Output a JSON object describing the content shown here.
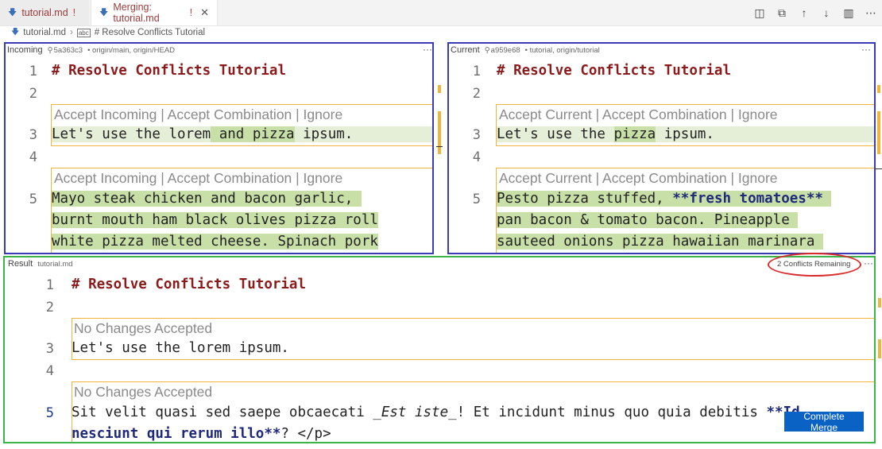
{
  "tabs": [
    {
      "label": "tutorial.md",
      "modified": "!",
      "close": ""
    },
    {
      "label": "Merging: tutorial.md",
      "modified": "!",
      "close": "✕"
    }
  ],
  "breadcrumb": {
    "file": "tutorial.md",
    "sep": "›",
    "symbol": "# Resolve Conflicts Tutorial"
  },
  "incoming": {
    "title": "Incoming",
    "commit": "5a363c3",
    "refs": "• origin/main, origin/HEAD",
    "menu": "···",
    "line_numbers": [
      "1",
      "2",
      "3",
      "4",
      "5"
    ],
    "heading": "# Resolve Conflicts Tutorial",
    "codelens1": "Accept Incoming | Accept Combination | Ignore",
    "line3": {
      "pre": "Let's use the lorem",
      "hl": " and pizza",
      "post": " ipsum."
    },
    "codelens2": "Accept Incoming | Accept Combination | Ignore",
    "block": [
      "Mayo steak chicken and bacon garlic, ",
      "burnt mouth ham black olives pizza roll",
      "white pizza melted cheese. Spinach pork"
    ]
  },
  "current": {
    "title": "Current",
    "commit": "a959e68",
    "refs": "• tutorial, origin/tutorial",
    "menu": "···",
    "line_numbers": [
      "1",
      "2",
      "3",
      "4",
      "5"
    ],
    "heading": "# Resolve Conflicts Tutorial",
    "codelens1": "Accept Current | Accept Combination | Ignore",
    "line3": {
      "pre": "Let's use the ",
      "hl": "pizza",
      "post": " ipsum."
    },
    "codelens2": "Accept Current | Accept Combination | Ignore",
    "block_line1": {
      "pre": "Pesto pizza stuffed, ",
      "bold": "**fresh tomatoes**",
      "post": " "
    },
    "block_line2": "pan bacon & tomato bacon. Pineapple ",
    "block_line3": "sauteed onions pizza hawaiian marinara "
  },
  "result": {
    "title": "Result",
    "file": "tutorial.md",
    "menu": "···",
    "conflicts": "2 Conflicts Remaining",
    "line_numbers": [
      "1",
      "2",
      "3",
      "4",
      "5"
    ],
    "heading": "# Resolve Conflicts Tutorial",
    "codelens1": "No Changes Accepted",
    "line3": "Let's use the lorem ipsum.",
    "codelens2": "No Changes Accepted",
    "line5": {
      "pre": "Sit velit quasi sed saepe obcaecati ",
      "ital": "_Est iste_",
      "mid": "! Et incidunt minus quo quia debitis ",
      "bold1": "**Id"
    },
    "line5b": {
      "bold2": "nesciunt qui rerum illo**",
      "post": "? </p>"
    },
    "complete_merge": "Complete Merge"
  },
  "colors": {
    "incoming_border": "#3a3ab5",
    "result_border": "#3db34b",
    "conflict_marker": "#f0b63c",
    "annotation": "#d92b2b",
    "button": "#0a62c4"
  },
  "icons": {
    "toolbar": [
      "open-changes-icon",
      "copy-icon",
      "arrow-up-icon",
      "arrow-down-icon",
      "split-editor-icon",
      "more-icon"
    ]
  }
}
